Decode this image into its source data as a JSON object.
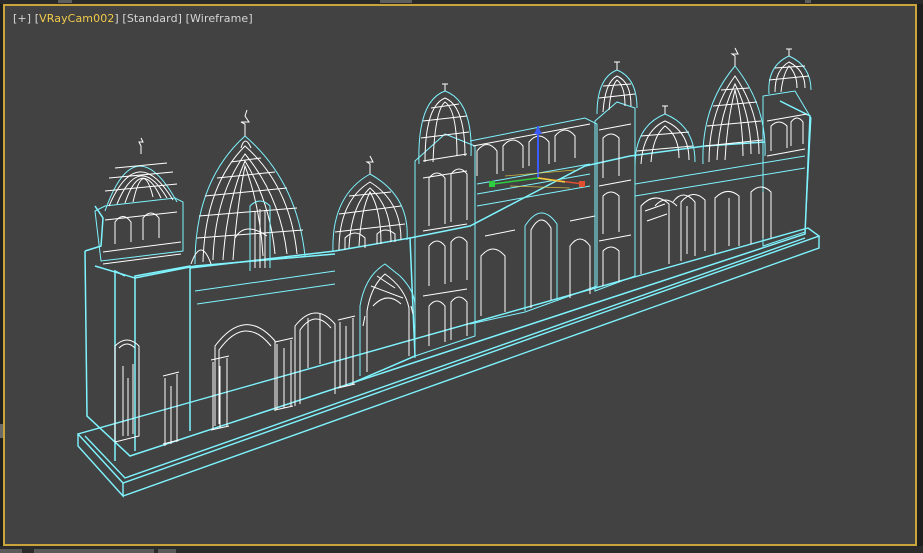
{
  "viewport": {
    "label_plus": "[+]",
    "label_camera": "VRayCam002",
    "label_standard": "Standard",
    "label_shading": "Wireframe"
  },
  "colors": {
    "viewport_bg": "#424242",
    "active_border": "#c9a43a",
    "selection_wire": "#7ff4ff",
    "inner_wire": "#ffffff",
    "camera_label": "#f0cc4a"
  },
  "scene": {
    "object": "Wireframe palace facade model (selected)",
    "gizmo": "transform-gizmo"
  }
}
